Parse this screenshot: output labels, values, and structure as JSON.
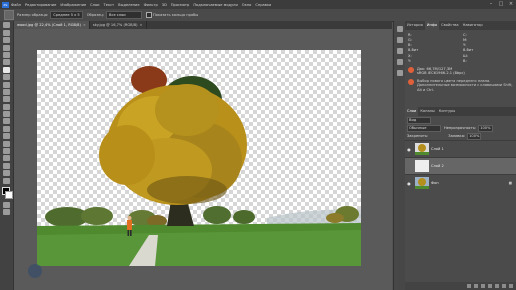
{
  "menu": [
    "Файл",
    "Редактирование",
    "Изображение",
    "Слои",
    "Текст",
    "Выделение",
    "Фильтр",
    "3D",
    "Просмотр",
    "Подключаемые модули",
    "Окно",
    "Справка"
  ],
  "options": {
    "size_label": "Размер образца:",
    "size_value": "Среднее 5 х 5",
    "sample_label": "Образец:",
    "sample_value": "Все слои",
    "show_ring": "Показать кольцо пробы"
  },
  "tabs": [
    {
      "label": "wood.jpg @ 22,4% (Слой 1, RGB/8)",
      "close": "×"
    },
    {
      "label": "sky.jpg @ 16,7% (RGB/8)",
      "close": "×"
    }
  ],
  "info_panel": {
    "tabs": [
      "История",
      "Инфо",
      "Свойства",
      "Навигатор"
    ],
    "active_tab": "Инфо",
    "rows": [
      {
        "k1": "R:",
        "k2": "C:"
      },
      {
        "k1": "G:",
        "k2": "M:"
      },
      {
        "k1": "B:",
        "k2": "Y:"
      },
      {
        "k1": "8-бит",
        "k2": "8-бит"
      },
      {
        "k1": "X:",
        "k2": "Ш:"
      },
      {
        "k1": "Y:",
        "k2": "В:"
      }
    ],
    "doc_lines": [
      "Док: 66,7M/127,3M",
      "sRGB IEC61966-2.1 (8bpc)"
    ],
    "note": "Выбор нового цвета переднего плана. Дополнительные возможности с клавишами Shift, Alt и Ctrl.",
    "colors": {
      "fg": "#e0603a",
      "bg": "#e0603a",
      "doc": "#e06a3a"
    }
  },
  "layers_panel": {
    "tabs": [
      "Слои",
      "Каналы",
      "Контуры"
    ],
    "filter_label": "Вид",
    "blend_mode": "Обычные",
    "opacity_label": "Непрозрачность:",
    "opacity_value": "100%",
    "lock_label": "Закрепить:",
    "fill_label": "Заливка:",
    "fill_value": "100%",
    "layers": [
      {
        "name": "Слой 1"
      },
      {
        "name": "Слой 2"
      },
      {
        "name": "Фон"
      }
    ]
  }
}
